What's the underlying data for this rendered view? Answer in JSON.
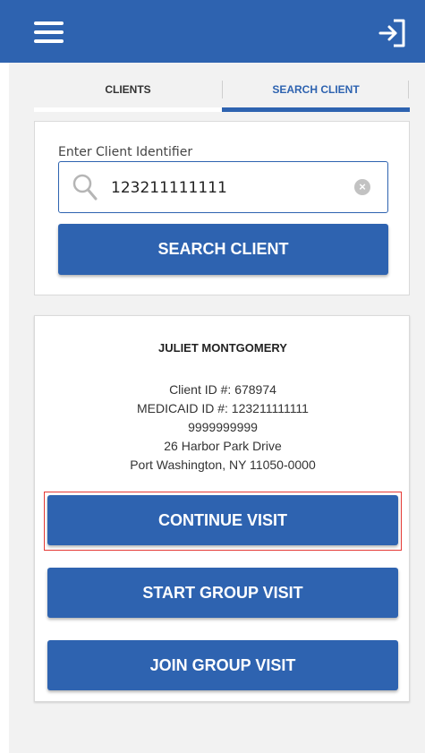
{
  "header": {
    "menu_icon": "hamburger-menu-icon",
    "logout_icon": "logout-arrow-icon",
    "background_color": "#2e63b0"
  },
  "tabs": [
    {
      "label": "CLIENTS",
      "active": false
    },
    {
      "label": "SEARCH CLIENT",
      "active": true
    }
  ],
  "search": {
    "label": "Enter Client Identifier",
    "value": "123211111111",
    "placeholder": "",
    "button_label": "SEARCH CLIENT"
  },
  "client": {
    "name": "JULIET MONTGOMERY",
    "client_id": "Client ID #: 678974",
    "medicaid_id": "MEDICAID ID #: 123211111111",
    "phone": "9999999999",
    "address_line1": "26 Harbor Park Drive",
    "address_line2": "Port Washington, NY 11050-0000"
  },
  "actions": {
    "continue_visit": "CONTINUE VISIT",
    "start_group_visit": "START GROUP VISIT",
    "join_group_visit": "JOIN GROUP VISIT"
  },
  "colors": {
    "accent": "#2e63b0",
    "highlight": "#e53935"
  }
}
